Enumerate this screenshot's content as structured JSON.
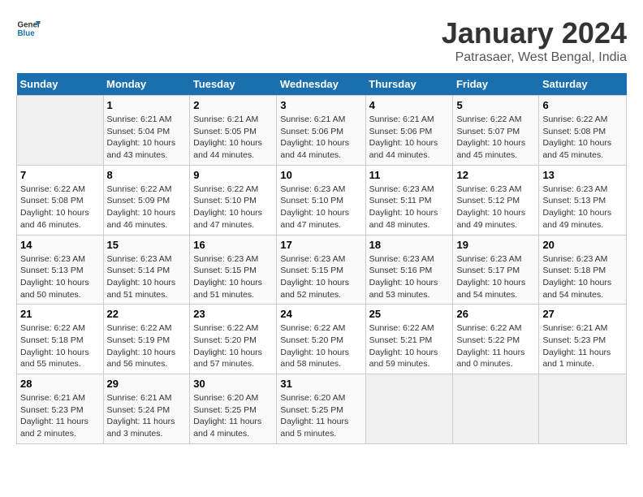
{
  "logo": {
    "line1": "General",
    "line2": "Blue"
  },
  "title": "January 2024",
  "subtitle": "Patrasaer, West Bengal, India",
  "days_header": [
    "Sunday",
    "Monday",
    "Tuesday",
    "Wednesday",
    "Thursday",
    "Friday",
    "Saturday"
  ],
  "weeks": [
    [
      {
        "day": "",
        "info": ""
      },
      {
        "day": "1",
        "info": "Sunrise: 6:21 AM\nSunset: 5:04 PM\nDaylight: 10 hours\nand 43 minutes."
      },
      {
        "day": "2",
        "info": "Sunrise: 6:21 AM\nSunset: 5:05 PM\nDaylight: 10 hours\nand 44 minutes."
      },
      {
        "day": "3",
        "info": "Sunrise: 6:21 AM\nSunset: 5:06 PM\nDaylight: 10 hours\nand 44 minutes."
      },
      {
        "day": "4",
        "info": "Sunrise: 6:21 AM\nSunset: 5:06 PM\nDaylight: 10 hours\nand 44 minutes."
      },
      {
        "day": "5",
        "info": "Sunrise: 6:22 AM\nSunset: 5:07 PM\nDaylight: 10 hours\nand 45 minutes."
      },
      {
        "day": "6",
        "info": "Sunrise: 6:22 AM\nSunset: 5:08 PM\nDaylight: 10 hours\nand 45 minutes."
      }
    ],
    [
      {
        "day": "7",
        "info": "Sunrise: 6:22 AM\nSunset: 5:08 PM\nDaylight: 10 hours\nand 46 minutes."
      },
      {
        "day": "8",
        "info": "Sunrise: 6:22 AM\nSunset: 5:09 PM\nDaylight: 10 hours\nand 46 minutes."
      },
      {
        "day": "9",
        "info": "Sunrise: 6:22 AM\nSunset: 5:10 PM\nDaylight: 10 hours\nand 47 minutes."
      },
      {
        "day": "10",
        "info": "Sunrise: 6:23 AM\nSunset: 5:10 PM\nDaylight: 10 hours\nand 47 minutes."
      },
      {
        "day": "11",
        "info": "Sunrise: 6:23 AM\nSunset: 5:11 PM\nDaylight: 10 hours\nand 48 minutes."
      },
      {
        "day": "12",
        "info": "Sunrise: 6:23 AM\nSunset: 5:12 PM\nDaylight: 10 hours\nand 49 minutes."
      },
      {
        "day": "13",
        "info": "Sunrise: 6:23 AM\nSunset: 5:13 PM\nDaylight: 10 hours\nand 49 minutes."
      }
    ],
    [
      {
        "day": "14",
        "info": "Sunrise: 6:23 AM\nSunset: 5:13 PM\nDaylight: 10 hours\nand 50 minutes."
      },
      {
        "day": "15",
        "info": "Sunrise: 6:23 AM\nSunset: 5:14 PM\nDaylight: 10 hours\nand 51 minutes."
      },
      {
        "day": "16",
        "info": "Sunrise: 6:23 AM\nSunset: 5:15 PM\nDaylight: 10 hours\nand 51 minutes."
      },
      {
        "day": "17",
        "info": "Sunrise: 6:23 AM\nSunset: 5:15 PM\nDaylight: 10 hours\nand 52 minutes."
      },
      {
        "day": "18",
        "info": "Sunrise: 6:23 AM\nSunset: 5:16 PM\nDaylight: 10 hours\nand 53 minutes."
      },
      {
        "day": "19",
        "info": "Sunrise: 6:23 AM\nSunset: 5:17 PM\nDaylight: 10 hours\nand 54 minutes."
      },
      {
        "day": "20",
        "info": "Sunrise: 6:23 AM\nSunset: 5:18 PM\nDaylight: 10 hours\nand 54 minutes."
      }
    ],
    [
      {
        "day": "21",
        "info": "Sunrise: 6:22 AM\nSunset: 5:18 PM\nDaylight: 10 hours\nand 55 minutes."
      },
      {
        "day": "22",
        "info": "Sunrise: 6:22 AM\nSunset: 5:19 PM\nDaylight: 10 hours\nand 56 minutes."
      },
      {
        "day": "23",
        "info": "Sunrise: 6:22 AM\nSunset: 5:20 PM\nDaylight: 10 hours\nand 57 minutes."
      },
      {
        "day": "24",
        "info": "Sunrise: 6:22 AM\nSunset: 5:20 PM\nDaylight: 10 hours\nand 58 minutes."
      },
      {
        "day": "25",
        "info": "Sunrise: 6:22 AM\nSunset: 5:21 PM\nDaylight: 10 hours\nand 59 minutes."
      },
      {
        "day": "26",
        "info": "Sunrise: 6:22 AM\nSunset: 5:22 PM\nDaylight: 11 hours\nand 0 minutes."
      },
      {
        "day": "27",
        "info": "Sunrise: 6:21 AM\nSunset: 5:23 PM\nDaylight: 11 hours\nand 1 minute."
      }
    ],
    [
      {
        "day": "28",
        "info": "Sunrise: 6:21 AM\nSunset: 5:23 PM\nDaylight: 11 hours\nand 2 minutes."
      },
      {
        "day": "29",
        "info": "Sunrise: 6:21 AM\nSunset: 5:24 PM\nDaylight: 11 hours\nand 3 minutes."
      },
      {
        "day": "30",
        "info": "Sunrise: 6:20 AM\nSunset: 5:25 PM\nDaylight: 11 hours\nand 4 minutes."
      },
      {
        "day": "31",
        "info": "Sunrise: 6:20 AM\nSunset: 5:25 PM\nDaylight: 11 hours\nand 5 minutes."
      },
      {
        "day": "",
        "info": ""
      },
      {
        "day": "",
        "info": ""
      },
      {
        "day": "",
        "info": ""
      }
    ]
  ]
}
